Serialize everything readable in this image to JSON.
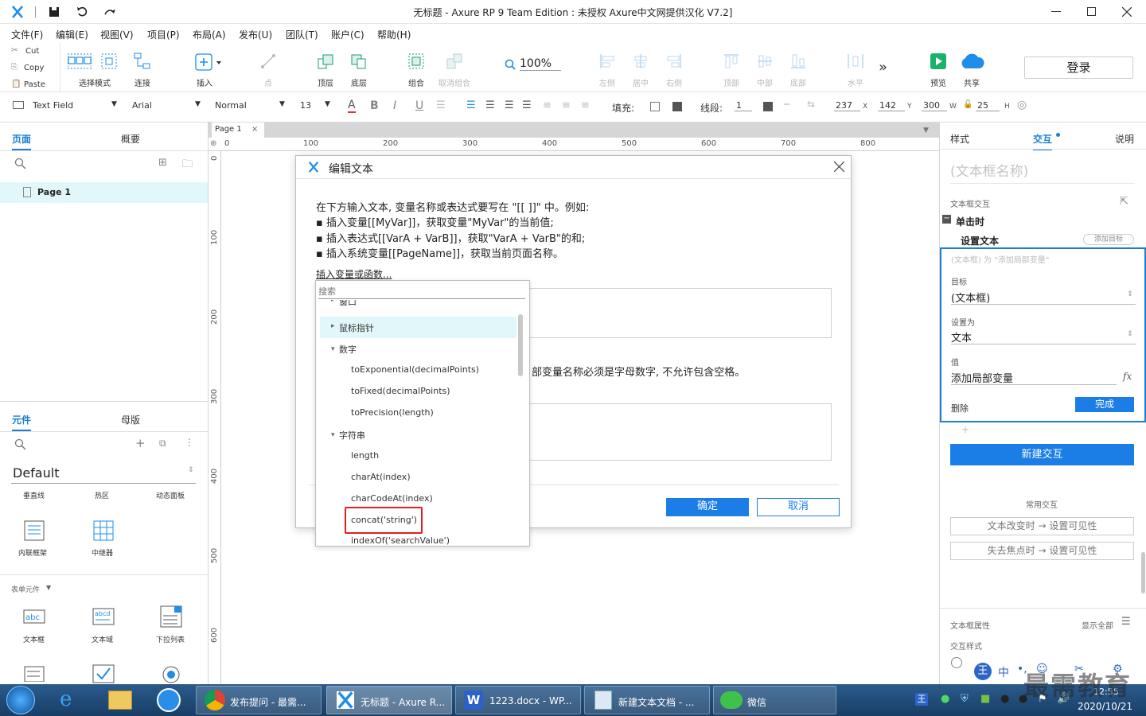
{
  "window": {
    "title": "无标题 - Axure RP 9 Team Edition : 未授权     Axure中文网提供汉化 V7.2]"
  },
  "menu": [
    "文件(F)",
    "编辑(E)",
    "视图(V)",
    "项目(P)",
    "布局(A)",
    "发布(U)",
    "团队(T)",
    "账户(C)",
    "帮助(H)"
  ],
  "clipboard": {
    "cut": "Cut",
    "copy": "Copy",
    "paste": "Paste"
  },
  "toolbar": {
    "select_mode": "选择模式",
    "connect": "连接",
    "insert": "插入",
    "point": "点",
    "top_layer": "顶层",
    "bottom_layer": "底层",
    "group": "组合",
    "ungroup": "取消组合",
    "zoom": "100%",
    "align_left": "左侧",
    "align_center": "居中",
    "align_right": "右侧",
    "align_top": "顶部",
    "align_middle": "中部",
    "align_bottom": "底部",
    "horizontal": "水平",
    "preview": "预览",
    "share": "共享",
    "login": "登录"
  },
  "format": {
    "widget_type": "Text Field",
    "font": "Arial",
    "style": "Normal",
    "size": "13",
    "fill_label": "填充:",
    "line_label": "线段:",
    "line_value": "1",
    "x": "237",
    "x_label": "X",
    "y": "142",
    "y_label": "Y",
    "w": "300",
    "w_label": "W",
    "h": "25",
    "h_label": "H"
  },
  "left": {
    "tab_pages": "页面",
    "tab_outline": "概要",
    "page_item": "Page 1",
    "tab_widgets": "元件",
    "tab_masters": "母版",
    "library": "Default",
    "widgets_row1": [
      "垂直线",
      "热区",
      "动态面板"
    ],
    "widgets_row2": [
      "内联框架",
      "中继器"
    ],
    "form_section": "表单元件",
    "form_widgets": [
      "文本框",
      "文本域",
      "下拉列表"
    ]
  },
  "canvas": {
    "tab": "Page 1",
    "ruler_top": [
      "0",
      "100",
      "200",
      "300",
      "400",
      "500",
      "600",
      "700",
      "800"
    ],
    "ruler_left": [
      "0",
      "100",
      "200",
      "300",
      "400",
      "500",
      "600"
    ]
  },
  "dialog": {
    "title": "编辑文本",
    "line1": "在下方输入文本, 变量名称或表达式要写在 \"[[ ]]\" 中。例如:",
    "line2": "▪ 插入变量[[MyVar]]，获取变量\"MyVar\"的当前值;",
    "line3": "▪ 插入表达式[[VarA + VarB]]，获取\"VarA + VarB\"的和;",
    "line4": "▪ 插入系统变量[[PageName]]，获取当前页面名称。",
    "insert_link": "插入变量或函数...",
    "local_var_note": "部变量名称必须是字母数字, 不允许包含空格。",
    "ok": "确定",
    "cancel": "取消"
  },
  "dropdown": {
    "search_placeholder": "搜索",
    "items": [
      "窗口",
      "鼠标指针",
      "数字",
      "toExponential(decimalPoints)",
      "toFixed(decimalPoints)",
      "toPrecision(length)",
      "字符串",
      "length",
      "charAt(index)",
      "charCodeAt(index)",
      "concat('string')",
      "indexOf('searchValue')"
    ]
  },
  "right": {
    "tab_style": "样式",
    "tab_interaction": "交互",
    "tab_notes": "说明",
    "widget_name_placeholder": "(文本框名称)",
    "section_interactions": "文本框交互",
    "event": "单击时",
    "action": "设置文本",
    "add_target": "添加目标",
    "summary": "(文本框) 为 \"添加局部变量\"",
    "target_label": "目标",
    "target_value": "(文本框)",
    "set_as_label": "设置为",
    "set_as_value": "文本",
    "value_label": "值",
    "value_value": "添加局部变量",
    "fx": "fx",
    "delete": "删除",
    "done": "完成",
    "new_interaction": "新建交互",
    "common_label": "常用交互",
    "common1": "文本改变时 → 设置可见性",
    "common2": "失去焦点时 → 设置可见性",
    "props_label": "文本框属性",
    "show_all": "显示全部",
    "interaction_style": "交互样式"
  },
  "taskbar": {
    "tasks": [
      "发布提问 - 最需...",
      "无标题 - Axure R...",
      "1223.docx - WP...",
      "新建文本文档 - ...",
      "微信"
    ],
    "tray_ime": "中",
    "time": "12:55",
    "date": "2020/10/21",
    "watermark": "最需教育"
  },
  "colors": {
    "accent": "#1a7ed6",
    "highlight_red": "#e02020",
    "tree_selected": "#e2f7f9"
  }
}
